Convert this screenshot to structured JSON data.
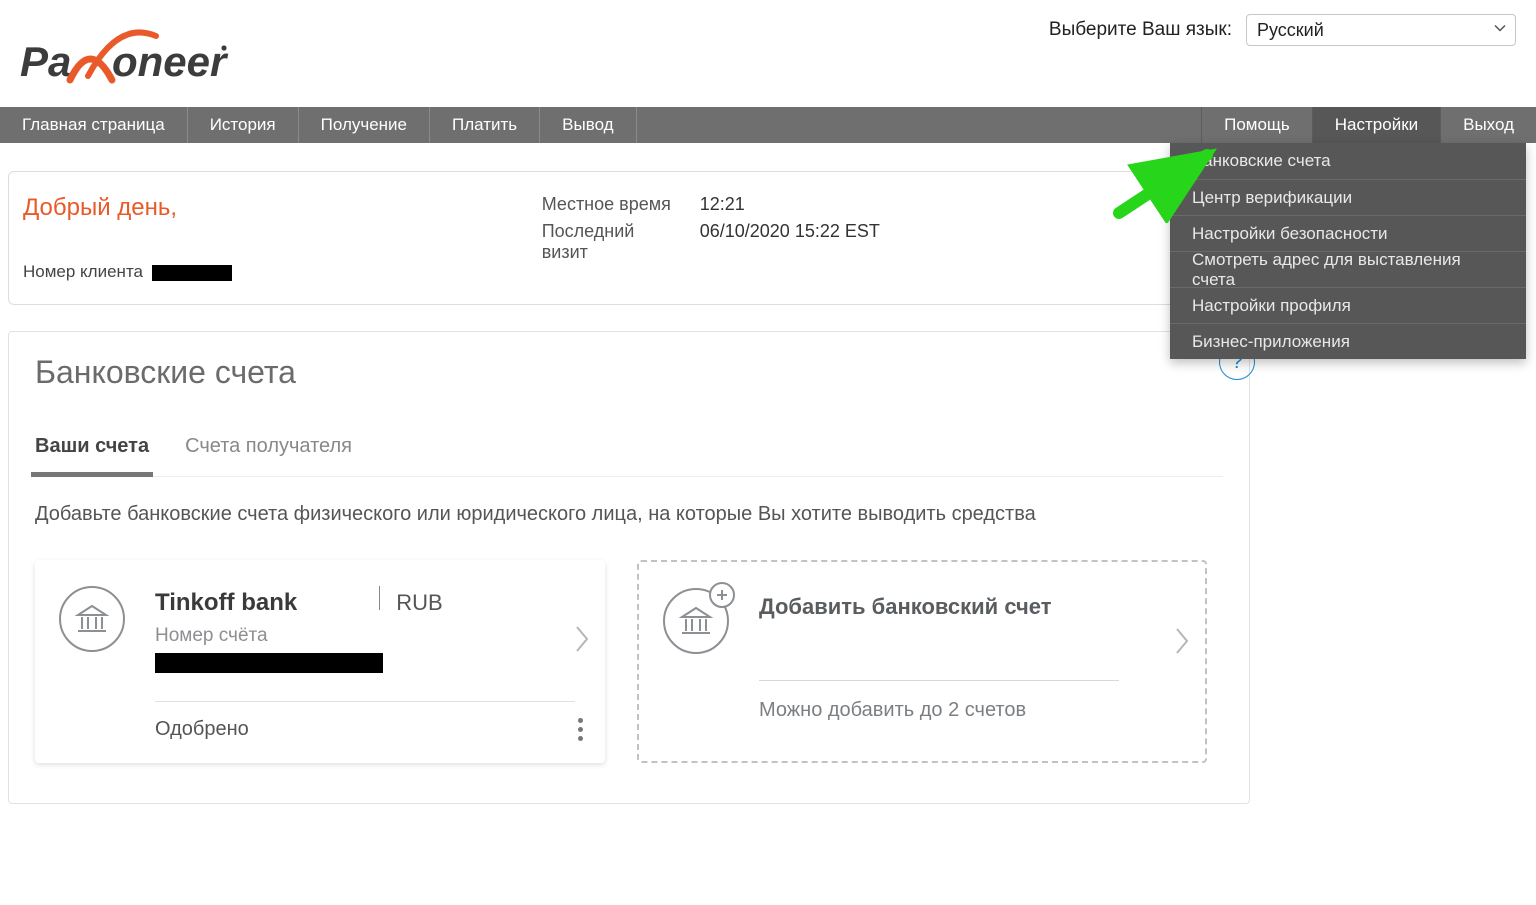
{
  "header": {
    "lang_label": "Выберите Ваш язык:",
    "lang_selected": "Русский"
  },
  "nav": {
    "left": [
      "Главная страница",
      "История",
      "Получение",
      "Платить",
      "Вывод"
    ],
    "right": [
      "Помощь",
      "Настройки",
      "Выход"
    ],
    "active_right_index": 1
  },
  "settings_dropdown": [
    "Банковские счета",
    "Центр верификации",
    "Настройки безопасности",
    "Смотреть адрес для выставления счета",
    "Настройки профиля",
    "Бизнес-приложения"
  ],
  "greeting": {
    "hello": "Добрый день,",
    "client_label": "Номер клиента",
    "rows": [
      {
        "lbl": "Местное время",
        "val": "12:21"
      },
      {
        "lbl": "Последний визит",
        "val": "06/10/2020 15:22 EST"
      }
    ]
  },
  "panel": {
    "title": "Банковские счета",
    "help": "?",
    "tabs": [
      "Ваши счета",
      "Счета получателя"
    ],
    "active_tab": 0,
    "instruction": "Добавьте банковские счета физического или юридического лица, на которые Вы хотите выводить средства"
  },
  "bank_card": {
    "name": "Tinkoff bank",
    "currency": "RUB",
    "acct_label": "Номер счёта",
    "status": "Одобрено"
  },
  "add_card": {
    "title": "Добавить банковский счет",
    "subtitle": "Можно добавить до 2 счетов"
  }
}
